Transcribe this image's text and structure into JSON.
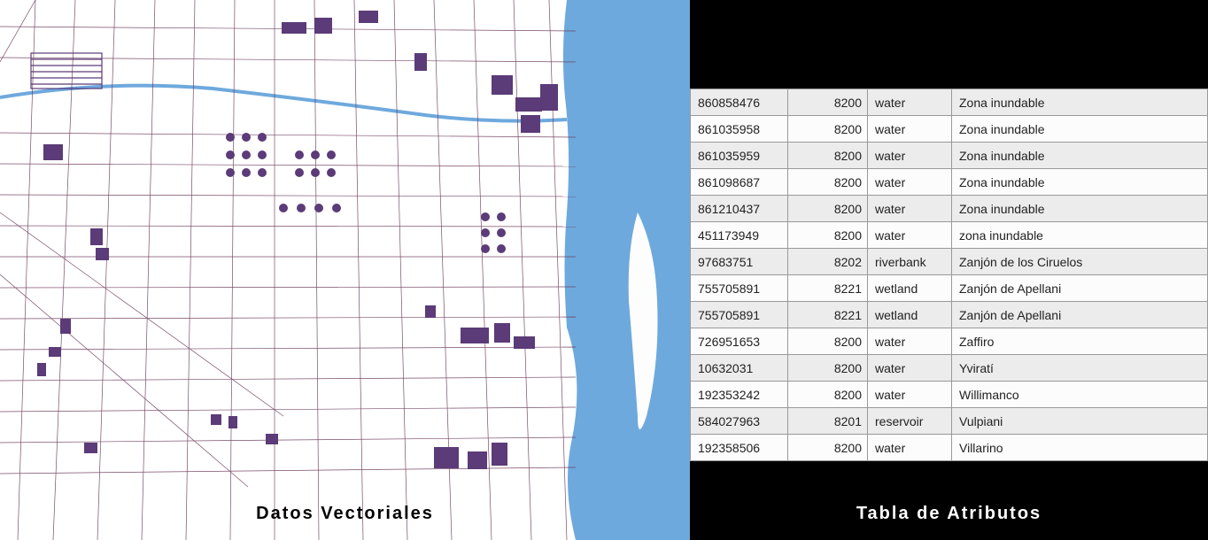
{
  "left": {
    "caption": "Datos Vectoriales"
  },
  "right": {
    "caption": "Tabla de Atributos",
    "rows": [
      {
        "id": "860858476",
        "code": "8200",
        "type": "water",
        "name": "Zona inundable"
      },
      {
        "id": "861035958",
        "code": "8200",
        "type": "water",
        "name": "Zona inundable"
      },
      {
        "id": "861035959",
        "code": "8200",
        "type": "water",
        "name": "Zona inundable"
      },
      {
        "id": "861098687",
        "code": "8200",
        "type": "water",
        "name": "Zona inundable"
      },
      {
        "id": "861210437",
        "code": "8200",
        "type": "water",
        "name": "Zona inundable"
      },
      {
        "id": "451173949",
        "code": "8200",
        "type": "water",
        "name": "zona inundable"
      },
      {
        "id": "97683751",
        "code": "8202",
        "type": "riverbank",
        "name": "Zanjón de los Ciruelos"
      },
      {
        "id": "755705891",
        "code": "8221",
        "type": "wetland",
        "name": "Zanjón de Apellani"
      },
      {
        "id": "755705891",
        "code": "8221",
        "type": "wetland",
        "name": "Zanjón de Apellani"
      },
      {
        "id": "726951653",
        "code": "8200",
        "type": "water",
        "name": "Zaffiro"
      },
      {
        "id": "10632031",
        "code": "8200",
        "type": "water",
        "name": "Yviratí"
      },
      {
        "id": "192353242",
        "code": "8200",
        "type": "water",
        "name": "Willimanco"
      },
      {
        "id": "584027963",
        "code": "8201",
        "type": "reservoir",
        "name": "Vulpiani"
      },
      {
        "id": "192358506",
        "code": "8200",
        "type": "water",
        "name": "Villarino"
      }
    ]
  }
}
